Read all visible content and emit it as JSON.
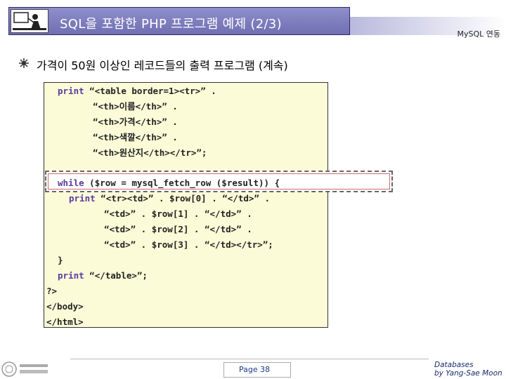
{
  "header": {
    "title": "SQL을 포함한 PHP 프로그램 예제 (2/3)",
    "topic": "MySQL 연동"
  },
  "slide": {
    "heading": "가격이 50원 이상인 레코드들의 출력 프로그램 (계속)"
  },
  "code": {
    "l1_kw": "print",
    "l1": " “<table border=1><tr>” .",
    "l2": "“<th>이름</th>” .",
    "l3": "“<th>가격</th>” .",
    "l4": "“<th>색깔</th>” .",
    "l5": "“<th>원산지</th></tr>”;",
    "l6_kw": "while",
    "l6": " ($row = mysql_fetch_row ($result)) {",
    "l7_kw": "print",
    "l7": " “<tr><td>” . $row[0] . “</td>” .",
    "l8": "“<td>” . $row[1] . “</td>” .",
    "l9": "“<td>” . $row[2] . “</td>” .",
    "l10": "“<td>” . $row[3] . “</td></tr>”;",
    "l11": "}",
    "l12_kw": "print",
    "l12": " “</table>”;",
    "l13": "?>",
    "l14": "</body>",
    "l15": "</html>"
  },
  "footer": {
    "page": "Page 38",
    "credit_line1": "Databases",
    "credit_line2": "by Yang-Sae Moon"
  },
  "colors": {
    "banner": "#7f7fc0",
    "code_bg": "#fbfbd8",
    "keyword": "#5a3aa0"
  }
}
